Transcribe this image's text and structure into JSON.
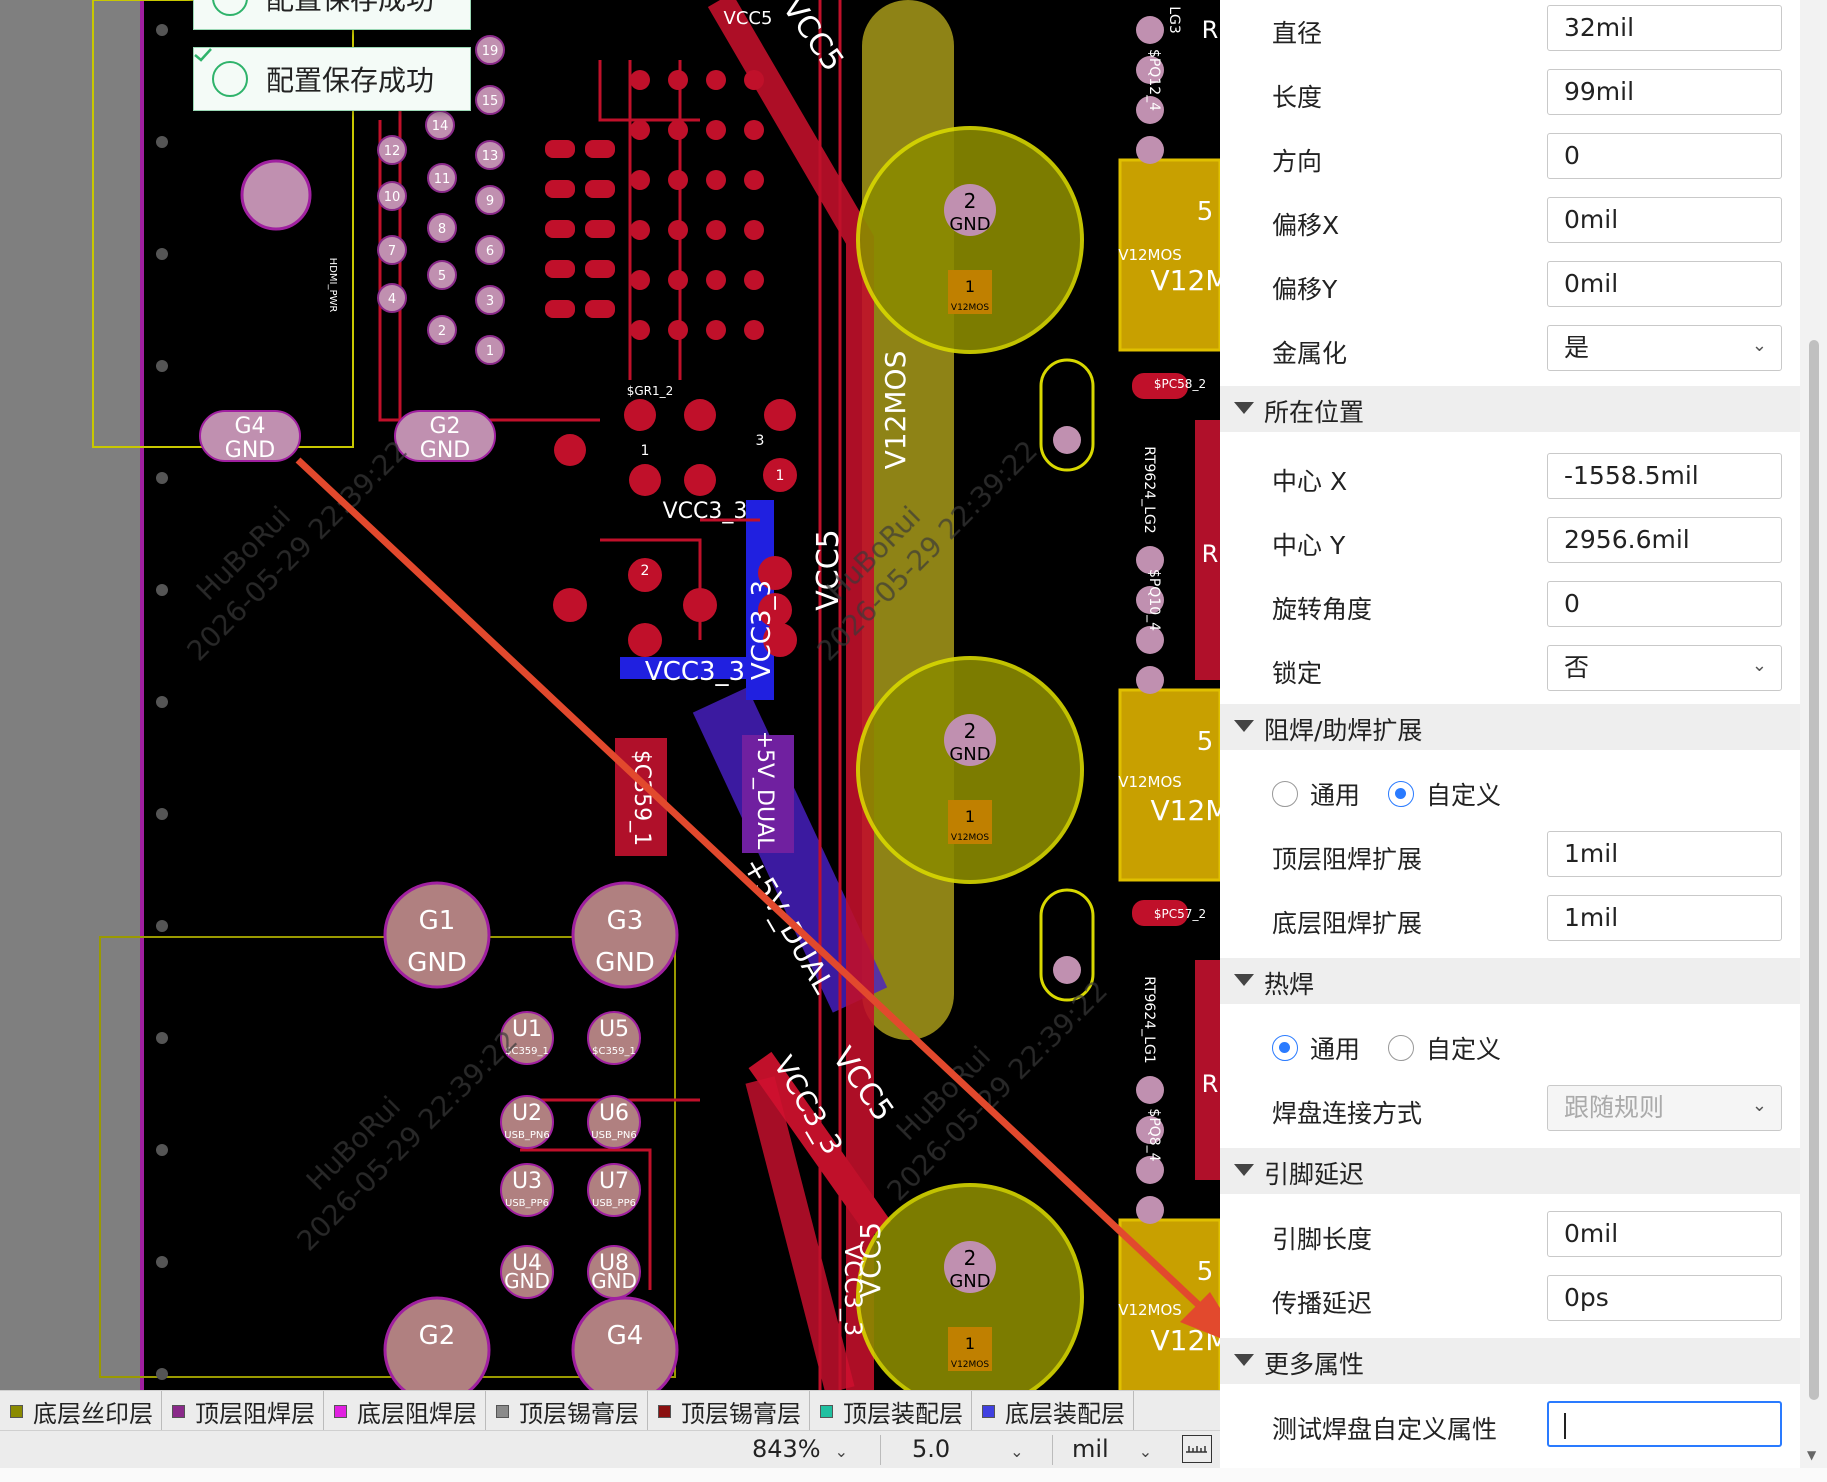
{
  "toasts": [
    {
      "message": "配置保存成功"
    },
    {
      "message": "配置保存成功"
    }
  ],
  "pcb": {
    "pads_top": [
      {
        "num": "G4",
        "net": "GND"
      },
      {
        "num": "G2",
        "net": "GND"
      }
    ],
    "pads_big": [
      {
        "num": "G1",
        "net": "GND"
      },
      {
        "num": "G3",
        "net": "GND"
      },
      {
        "num": "G2",
        "net": ""
      },
      {
        "num": "G4",
        "net": ""
      }
    ],
    "small_pads": [
      {
        "num": "U1",
        "net": "$C359_1"
      },
      {
        "num": "U5",
        "net": "$C359_1"
      },
      {
        "num": "U2",
        "net": "USB_PN6"
      },
      {
        "num": "U6",
        "net": "USB_PN6"
      },
      {
        "num": "U3",
        "net": "USB_PP6"
      },
      {
        "num": "U7",
        "net": "USB_PP6"
      },
      {
        "num": "U4",
        "net": "GND"
      },
      {
        "num": "U8",
        "net": "GND"
      }
    ],
    "pin_numbers": [
      "19",
      "15",
      "14",
      "13",
      "12",
      "11",
      "10",
      "9",
      "8",
      "7",
      "6",
      "5",
      "4",
      "3",
      "2",
      "1"
    ],
    "nets": {
      "vcc5": "VCC5",
      "vcc3_3": "VCC3_3",
      "v12mos": "V12MOS",
      "v5dual": "+5V_DUAL",
      "gnd": "GND",
      "hdmi_pwr": "HDMI_PWR",
      "sgr1": "$GR1_2",
      "c359": "$C359_1",
      "rt_lg2": "RT9624_LG2",
      "rt_lg1": "RT9624_LG1",
      "lg3": "LG3",
      "pq12": "$PQ12_4",
      "pq10": "$PQ10_4",
      "pq8": "$PQ8_4",
      "pc58": "$PC58_2",
      "pc57": "$PC57_2",
      "v12m": "V12M",
      "five": "5",
      "r": "R",
      "one": "1",
      "two": "2",
      "three": "3"
    },
    "watermark": {
      "user": "HuBoRui",
      "time": "2026-05-29 22:39:22"
    }
  },
  "properties": {
    "rows_top": [
      {
        "label": "直径",
        "value": "32mil"
      },
      {
        "label": "长度",
        "value": "99mil"
      },
      {
        "label": "方向",
        "value": "0"
      },
      {
        "label": "偏移X",
        "value": "0mil"
      },
      {
        "label": "偏移Y",
        "value": "0mil"
      }
    ],
    "metallize": {
      "label": "金属化",
      "value": "是"
    },
    "section_position": "所在位置",
    "position_rows": [
      {
        "label": "中心 X",
        "value": "-1558.5mil"
      },
      {
        "label": "中心 Y",
        "value": "2956.6mil"
      },
      {
        "label": "旋转角度",
        "value": "0"
      }
    ],
    "lock": {
      "label": "锁定",
      "value": "否"
    },
    "section_mask": "阻焊/助焊扩展",
    "mask_mode": {
      "opt1": "通用",
      "opt2": "自定义",
      "selected": "自定义"
    },
    "mask_rows": [
      {
        "label": "顶层阻焊扩展",
        "value": "1mil"
      },
      {
        "label": "底层阻焊扩展",
        "value": "1mil"
      }
    ],
    "section_thermal": "热焊",
    "thermal_mode": {
      "opt1": "通用",
      "opt2": "自定义",
      "selected": "通用"
    },
    "thermal_conn": {
      "label": "焊盘连接方式",
      "value": "跟随规则"
    },
    "section_delay": "引脚延迟",
    "delay_rows": [
      {
        "label": "引脚长度",
        "value": "0mil"
      },
      {
        "label": "传播延迟",
        "value": "0ps"
      }
    ],
    "section_more": "更多属性",
    "custom_attr": {
      "label": "测试焊盘自定义属性",
      "value": ""
    }
  },
  "layers": [
    {
      "name": "底层丝印层",
      "color": "#8a8a00"
    },
    {
      "name": "顶层阻焊层",
      "color": "#8a2a8a"
    },
    {
      "name": "底层阻焊层",
      "color": "#e020e0"
    },
    {
      "name": "顶层锡膏层",
      "color": "#8a8a8a"
    },
    {
      "name": "顶层锡膏层",
      "color": "#8a1010"
    },
    {
      "name": "顶层装配层",
      "color": "#20c0a0"
    },
    {
      "name": "底层装配层",
      "color": "#4040e0"
    }
  ],
  "status": {
    "zoom": "843%",
    "grid": "5.0",
    "unit": "mil"
  },
  "colors": {
    "top_copper": "#d0102a",
    "bottom_copper": "#2020e0",
    "silk_top": "#d8d800",
    "pad_pink": "#c090b0",
    "annotation_arrow": "#e2492d"
  }
}
